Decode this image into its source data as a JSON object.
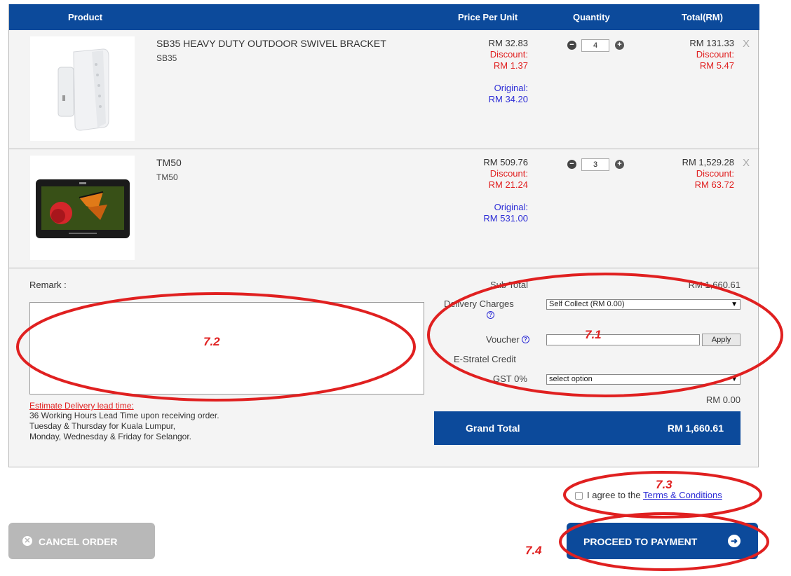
{
  "table_header": {
    "product": "Product",
    "price_per_unit": "Price Per Unit",
    "quantity": "Quantity",
    "total": "Total(RM)"
  },
  "items": [
    {
      "name": "SB35 HEAVY DUTY OUTDOOR SWIVEL BRACKET",
      "code": "SB35",
      "price": "RM 32.83",
      "discount_label": "Discount:",
      "discount": "RM 1.37",
      "original_label": "Original:",
      "original": "RM 34.20",
      "quantity": "4",
      "total": "RM 131.33",
      "total_discount_label": "Discount:",
      "total_discount": "RM 5.47",
      "remove": "X"
    },
    {
      "name": "TM50",
      "code": "TM50",
      "price": "RM 509.76",
      "discount_label": "Discount:",
      "discount": "RM 21.24",
      "original_label": "Original:",
      "original": "RM 531.00",
      "quantity": "3",
      "total": "RM 1,529.28",
      "total_discount_label": "Discount:",
      "total_discount": "RM 63.72",
      "remove": "X"
    }
  ],
  "remark": {
    "label": "Remark :",
    "value": "",
    "lead_time_link": "Estimate Delivery lead time:",
    "lead_time_lines": [
      "36 Working Hours Lead Time upon receiving order.",
      "Tuesday & Thursday for Kuala Lumpur,",
      "Monday, Wednesday & Friday for Selangor."
    ]
  },
  "summary": {
    "sub_total_label": "Sub Total",
    "sub_total": "RM 1,660.61",
    "delivery_label": "Delivery Charges",
    "delivery_selected": "Self Collect (RM 0.00)",
    "voucher_label": "Voucher",
    "voucher_value": "",
    "apply_label": "Apply",
    "credit_label": "E-Stratel Credit",
    "gst_label": "GST 0%",
    "gst_selected": "select option",
    "gst_value": "RM 0.00",
    "grand_total_label": "Grand Total",
    "grand_total": "RM 1,660.61"
  },
  "terms": {
    "prefix": "I agree to the",
    "link": "Terms & Conditions"
  },
  "buttons": {
    "cancel": "CANCEL ORDER",
    "proceed": "PROCEED TO PAYMENT"
  },
  "annotations": {
    "a71": "7.1",
    "a72": "7.2",
    "a73": "7.3",
    "a74": "7.4"
  },
  "icons": {
    "help": "question-circle-icon",
    "minus": "minus-circle-icon",
    "plus": "plus-circle-icon",
    "cancel": "times-circle-icon",
    "proceed": "arrow-circle-right-icon"
  },
  "colors": {
    "primary": "#0c4a9b",
    "discount": "#e02020",
    "original": "#2d2dd6",
    "annotation": "#e02020"
  }
}
